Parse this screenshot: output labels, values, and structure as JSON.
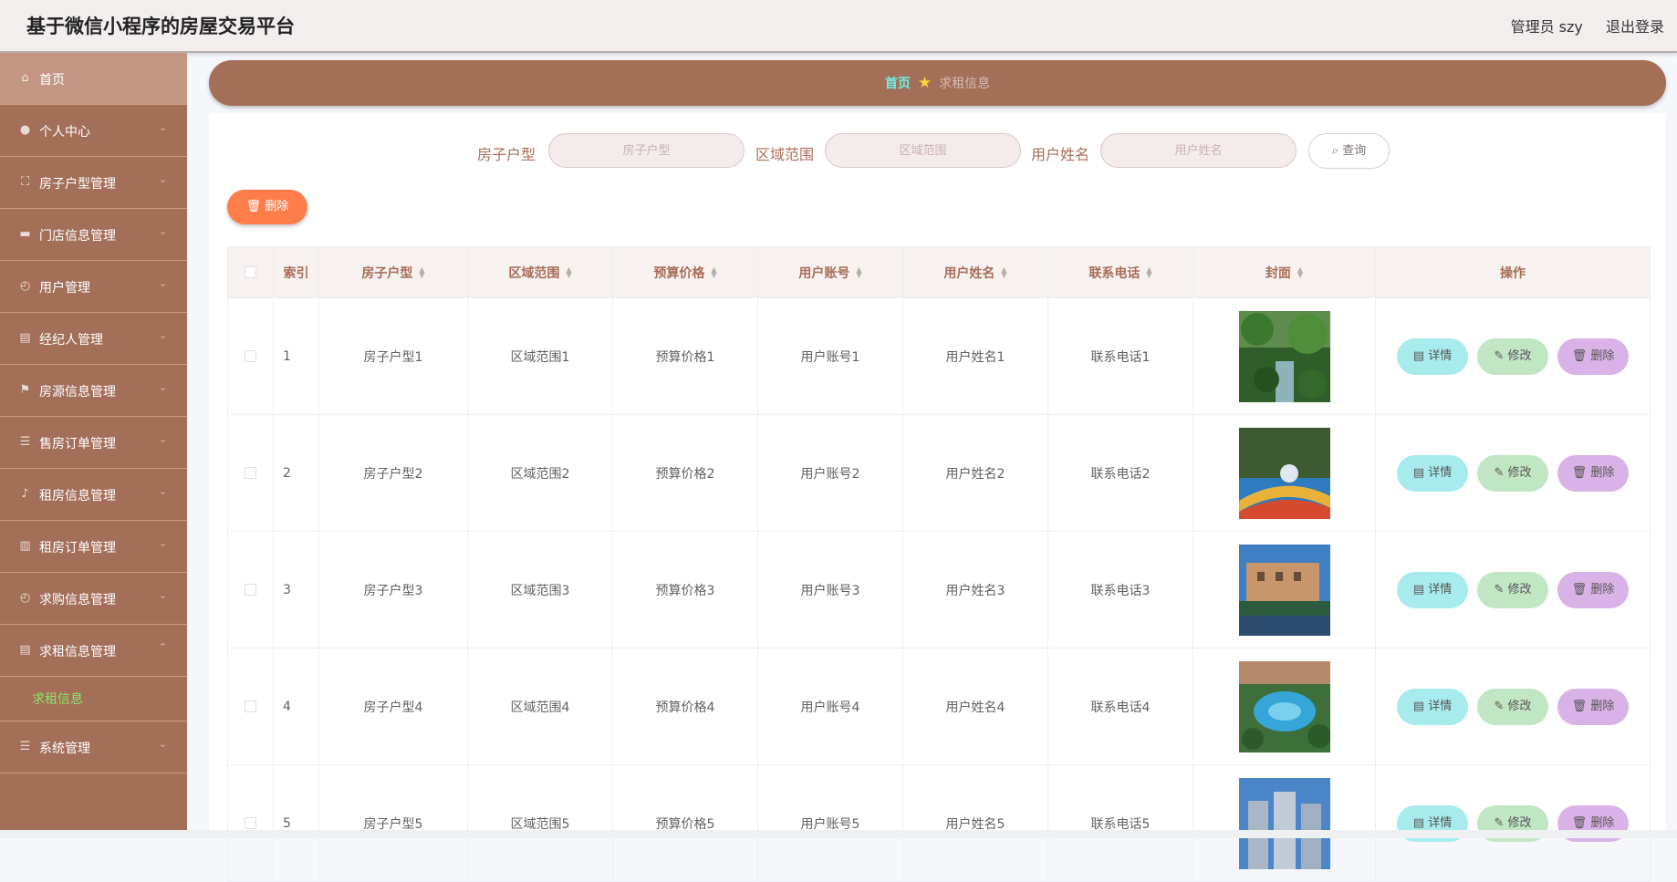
{
  "header": {
    "title": "基于微信小程序的房屋交易平台",
    "user": "管理员 szy",
    "logout": "退出登录"
  },
  "sidebar": {
    "items": [
      {
        "label": "首页",
        "icon": "home-icon"
      },
      {
        "label": "个人中心",
        "icon": "user-icon"
      },
      {
        "label": "房子户型管理",
        "icon": "frame-icon"
      },
      {
        "label": "门店信息管理",
        "icon": "monitor-icon"
      },
      {
        "label": "用户管理",
        "icon": "gauge-icon"
      },
      {
        "label": "经纪人管理",
        "icon": "clipboard-icon"
      },
      {
        "label": "房源信息管理",
        "icon": "flag-icon"
      },
      {
        "label": "售房订单管理",
        "icon": "list-icon"
      },
      {
        "label": "租房信息管理",
        "icon": "bell-icon"
      },
      {
        "label": "租房订单管理",
        "icon": "chart-icon"
      },
      {
        "label": "求购信息管理",
        "icon": "gauge-icon"
      },
      {
        "label": "求租信息管理",
        "icon": "clipboard-icon"
      }
    ],
    "sub_item": "求租信息",
    "last_item": {
      "label": "系统管理",
      "icon": "list-icon"
    }
  },
  "breadcrumb": {
    "home": "首页",
    "current": "求租信息"
  },
  "search": {
    "label1": "房子户型",
    "placeholder1": "房子户型",
    "label2": "区域范围",
    "placeholder2": "区域范围",
    "label3": "用户姓名",
    "placeholder3": "用户姓名",
    "button": "查询"
  },
  "bulk_delete": "删除",
  "table": {
    "headers": [
      "索引",
      "房子户型",
      "区域范围",
      "预算价格",
      "用户账号",
      "用户姓名",
      "联系电话",
      "封面",
      "操作"
    ],
    "rows": [
      {
        "index": "1",
        "type": "房子户型1",
        "area": "区域范围1",
        "price": "预算价格1",
        "account": "用户账号1",
        "name": "用户姓名1",
        "phone": "联系电话1"
      },
      {
        "index": "2",
        "type": "房子户型2",
        "area": "区域范围2",
        "price": "预算价格2",
        "account": "用户账号2",
        "name": "用户姓名2",
        "phone": "联系电话2"
      },
      {
        "index": "3",
        "type": "房子户型3",
        "area": "区域范围3",
        "price": "预算价格3",
        "account": "用户账号3",
        "name": "用户姓名3",
        "phone": "联系电话3"
      },
      {
        "index": "4",
        "type": "房子户型4",
        "area": "区域范围4",
        "price": "预算价格4",
        "account": "用户账号4",
        "name": "用户姓名4",
        "phone": "联系电话4"
      },
      {
        "index": "5",
        "type": "房子户型5",
        "area": "区域范围5",
        "price": "预算价格5",
        "account": "用户账号5",
        "name": "用户姓名5",
        "phone": "联系电话5"
      }
    ],
    "actions": {
      "detail": "详情",
      "edit": "修改",
      "delete": "删除"
    }
  },
  "colors": {
    "sidebar": "#a36f58",
    "accent": "#ff7d4a",
    "active_sub": "#8ee36b"
  }
}
